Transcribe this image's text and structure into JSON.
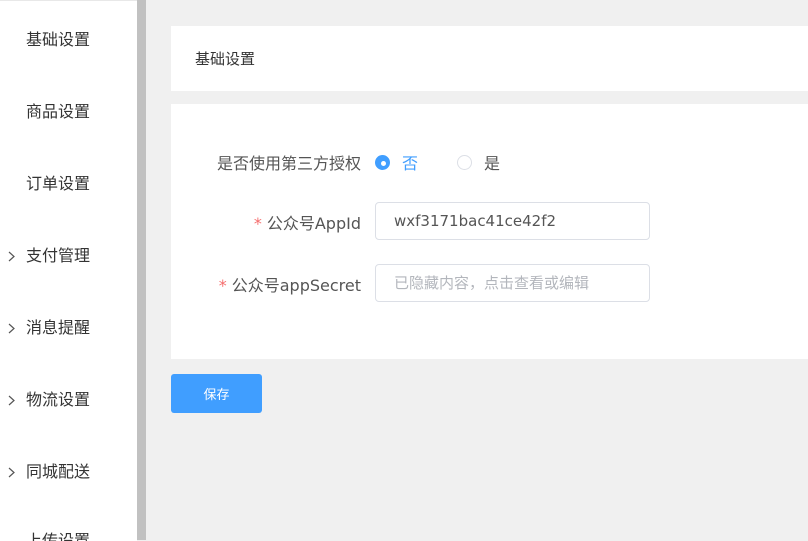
{
  "sidebar": {
    "items": [
      {
        "label": "基础设置",
        "has_children": false
      },
      {
        "label": "商品设置",
        "has_children": false
      },
      {
        "label": "订单设置",
        "has_children": false
      },
      {
        "label": "支付管理",
        "has_children": true
      },
      {
        "label": "消息提醒",
        "has_children": true
      },
      {
        "label": "物流设置",
        "has_children": true
      },
      {
        "label": "同城配送",
        "has_children": true
      },
      {
        "label": "上传设置",
        "has_children": false
      }
    ]
  },
  "header": {
    "title": "基础设置"
  },
  "form": {
    "third_party_auth": {
      "label": "是否使用第三方授权",
      "options": [
        "否",
        "是"
      ],
      "selected": "否"
    },
    "app_id": {
      "required_mark": "*",
      "label": "公众号AppId",
      "value": "wxf3171bac41ce42f2",
      "placeholder": ""
    },
    "app_secret": {
      "required_mark": "*",
      "label": "公众号appSecret",
      "value": "",
      "placeholder": "已隐藏内容，点击查看或编辑"
    }
  },
  "actions": {
    "save_label": "保存"
  },
  "colors": {
    "primary": "#409eff",
    "required": "#f56c6c",
    "background": "#f0f0f0"
  },
  "icons": {
    "submenu_indicator": "chevron-right-icon"
  }
}
